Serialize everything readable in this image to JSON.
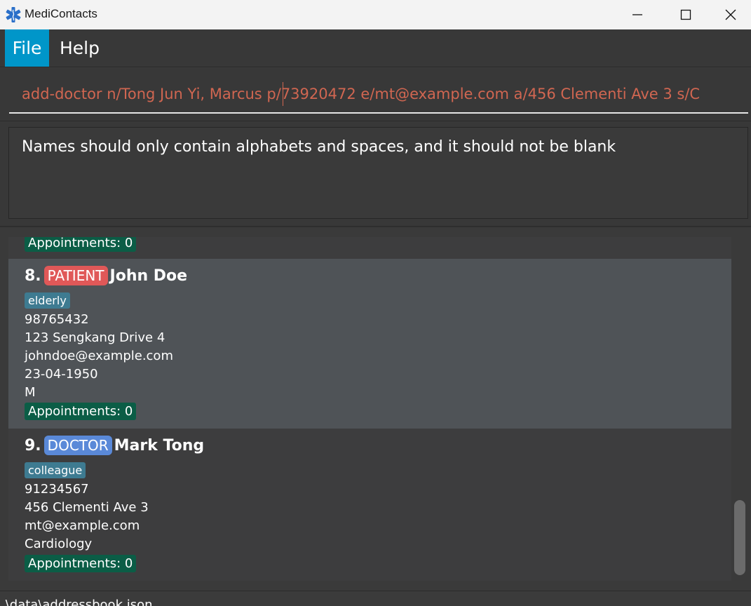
{
  "window": {
    "title": "MediContacts"
  },
  "menu": {
    "file": "File",
    "help": "Help"
  },
  "command": {
    "value": "add-doctor n/Tong Jun Yi, Marcus p/73920472 e/mt@example.com a/456 Clementi Ave 3 s/C"
  },
  "result": {
    "message": "Names should only contain alphabets and spaces, and it should not be blank"
  },
  "list": {
    "partial_appointments": "Appointments: 0",
    "cards": [
      {
        "number": "8.",
        "role": "PATIENT",
        "name": "John Doe",
        "tag": "elderly",
        "phone": "98765432",
        "address": "123 Sengkang Drive 4",
        "email": "johndoe@example.com",
        "dob": "23-04-1950",
        "gender": "M",
        "appointments": "Appointments: 0"
      },
      {
        "number": "9.",
        "role": "DOCTOR",
        "name": "Mark Tong",
        "tag": "colleague",
        "phone": "91234567",
        "address": "456 Clementi Ave 3",
        "email": "mt@example.com",
        "specialty": "Cardiology",
        "appointments": "Appointments: 0"
      }
    ]
  },
  "status": {
    "path": ".\\data\\addressbook.json"
  },
  "colors": {
    "accent": "#0096c9",
    "patient_badge": "#e05858",
    "doctor_badge": "#5a89d8",
    "tag": "#3e7b91",
    "appointments": "#0b5d46",
    "command_text": "#d06651"
  }
}
